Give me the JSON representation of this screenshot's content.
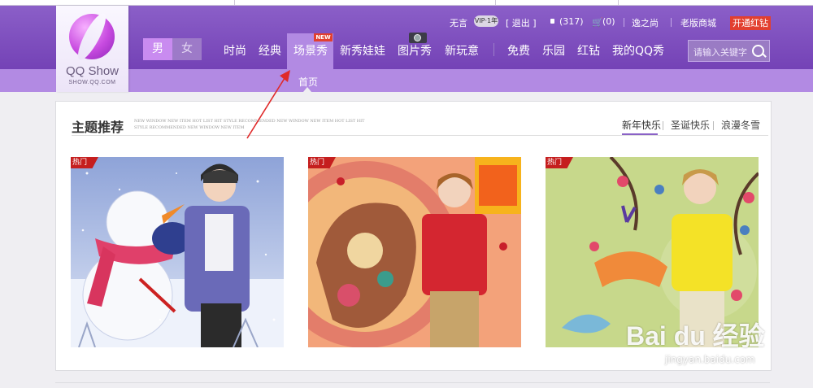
{
  "logo": {
    "name": "QQ Show",
    "domain": "SHOW.QQ.COM"
  },
  "toplinks": {
    "user": "无言",
    "vip_badge": "VIP·1年",
    "logout": "[ 退出 ]",
    "messages": "(317)",
    "cart": "(0)",
    "browse": "逸之尚",
    "old_mall": "老版商城",
    "open_red": "开通红钻"
  },
  "gender": {
    "male": "男",
    "female": "女"
  },
  "nav": {
    "items": [
      "时尚",
      "经典",
      "场景秀",
      "新秀娃娃",
      "图片秀",
      "新玩意",
      "免费",
      "乐园",
      "红钻",
      "我的QQ秀"
    ],
    "new_badge": "NEW",
    "active": "场景秀"
  },
  "search": {
    "placeholder": "请输入关键字"
  },
  "subnav": {
    "home": "首页"
  },
  "panel": {
    "title": "主题推荐",
    "tagline": "NEW WINDOW NEW ITEM HOT LIST HIT STYLE RECOMMENDED NEW WINDOW NEW ITEM HOT LIST HIT STYLE RECOMMENDED NEW WINDOW NEW ITEM",
    "tabs": [
      "新年快乐",
      "圣诞快乐",
      "浪漫冬雪"
    ],
    "active_tab": "新年快乐",
    "hot_label": "热门"
  },
  "watermark": {
    "brand": "Bai du 经验",
    "url": "jingyan.baidu.com"
  },
  "colors": {
    "header": "#7a4bbb",
    "subbar": "#b28ae3",
    "accent_red": "#e23f2f",
    "tab_underline": "#8a62c6"
  }
}
